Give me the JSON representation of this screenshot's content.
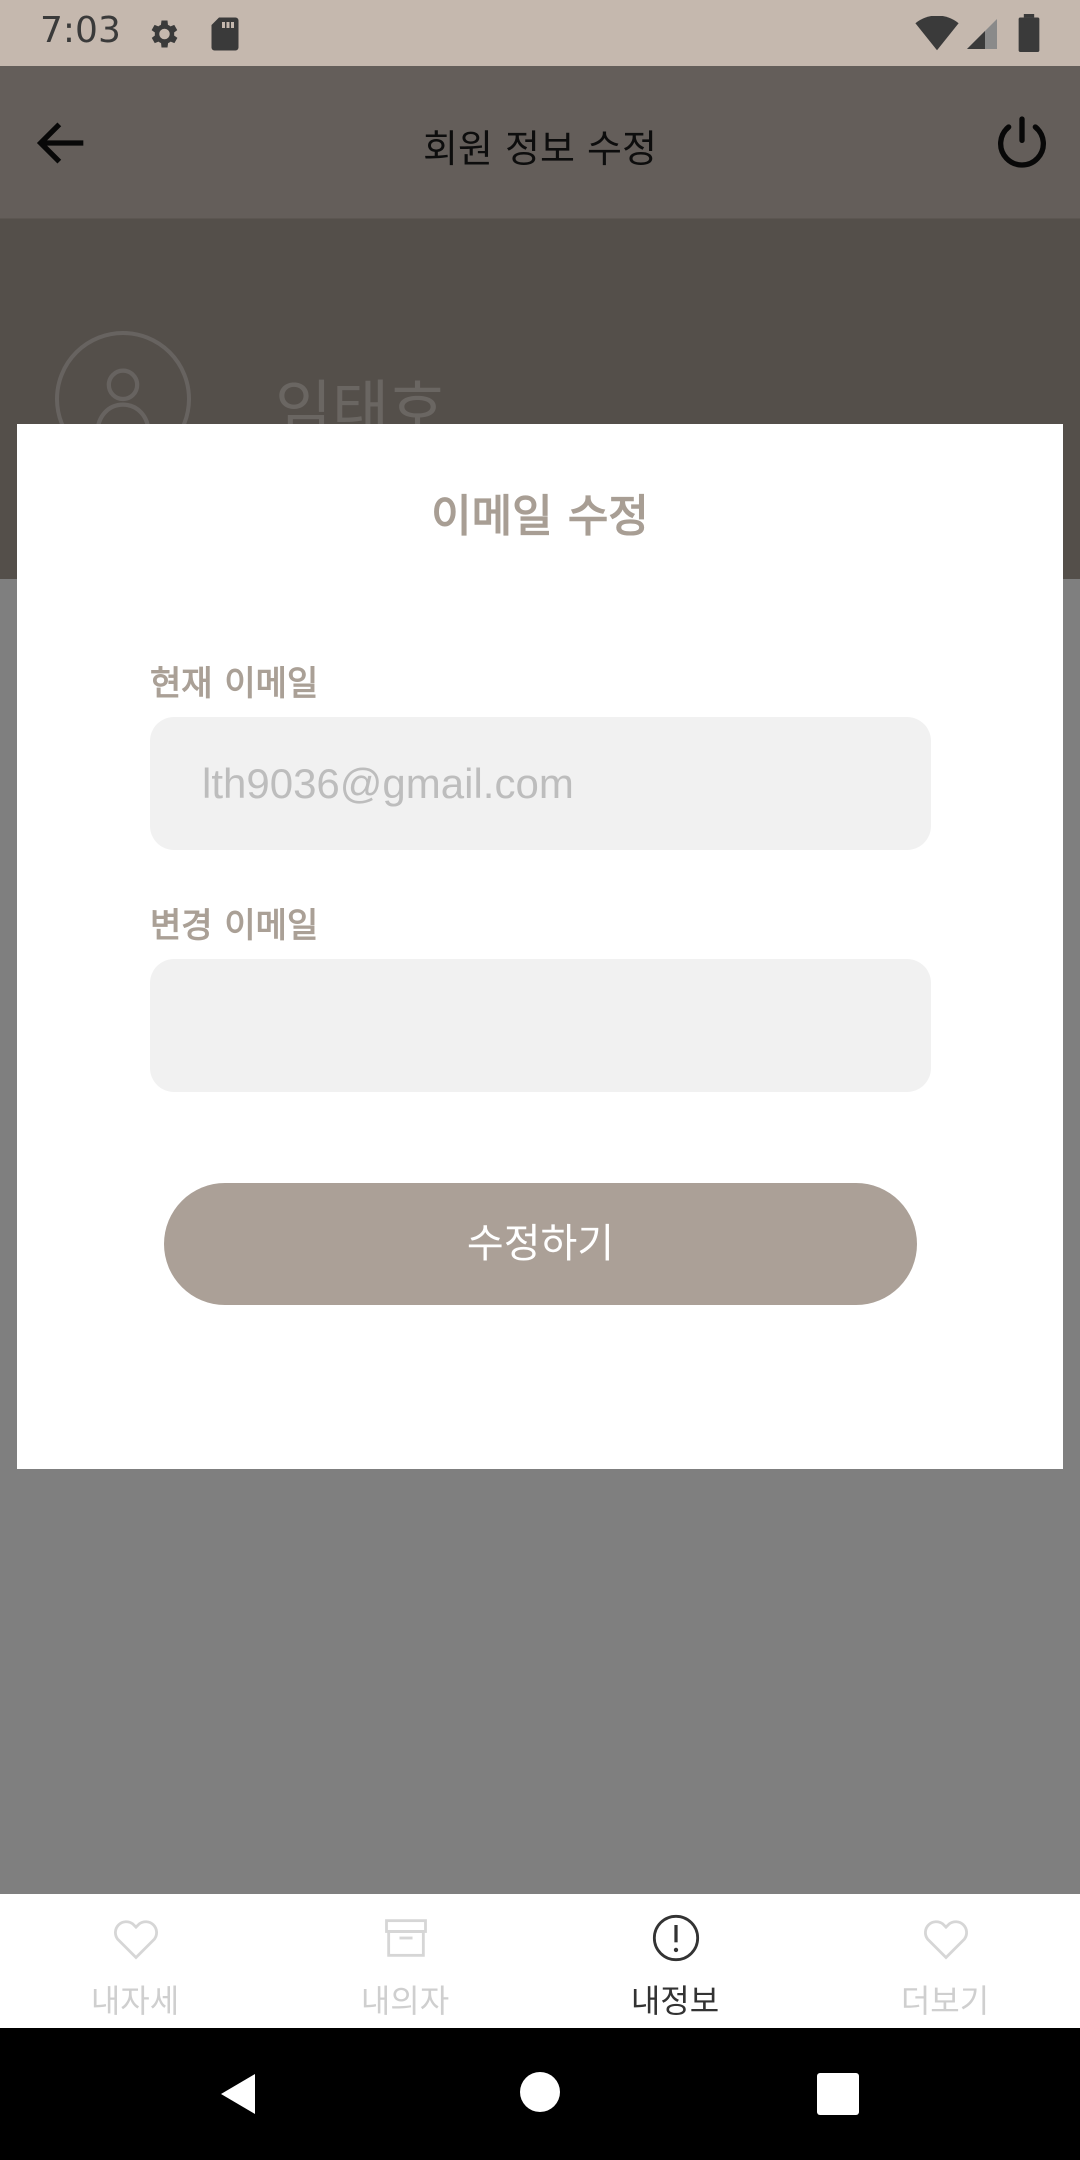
{
  "status_bar": {
    "time": "7:03",
    "icons": [
      "gear-icon",
      "sd-card-icon",
      "wifi-icon",
      "signal-icon",
      "battery-icon"
    ]
  },
  "app_bar": {
    "title": "회원 정보 수정",
    "back_icon": "arrow-left-icon",
    "power_icon": "power-icon"
  },
  "profile": {
    "name": "임태호",
    "avatar_icon": "person-icon"
  },
  "dialog": {
    "title": "이메일 수정",
    "current_label": "현재 이메일",
    "current_value": "lth9036@gmail.com",
    "new_label": "변경 이메일",
    "new_value": "",
    "submit_label": "수정하기"
  },
  "bottom_nav": {
    "items": [
      {
        "label": "내자세",
        "icon": "heart-icon",
        "active": false
      },
      {
        "label": "내의자",
        "icon": "archive-box-icon",
        "active": false
      },
      {
        "label": "내정보",
        "icon": "info-circle-icon",
        "active": true
      },
      {
        "label": "더보기",
        "icon": "heart-icon",
        "active": false
      }
    ]
  },
  "colors": {
    "status_bar": "#c5b8ae",
    "accent": "#aba097",
    "field_bg": "#f1f1f1"
  }
}
